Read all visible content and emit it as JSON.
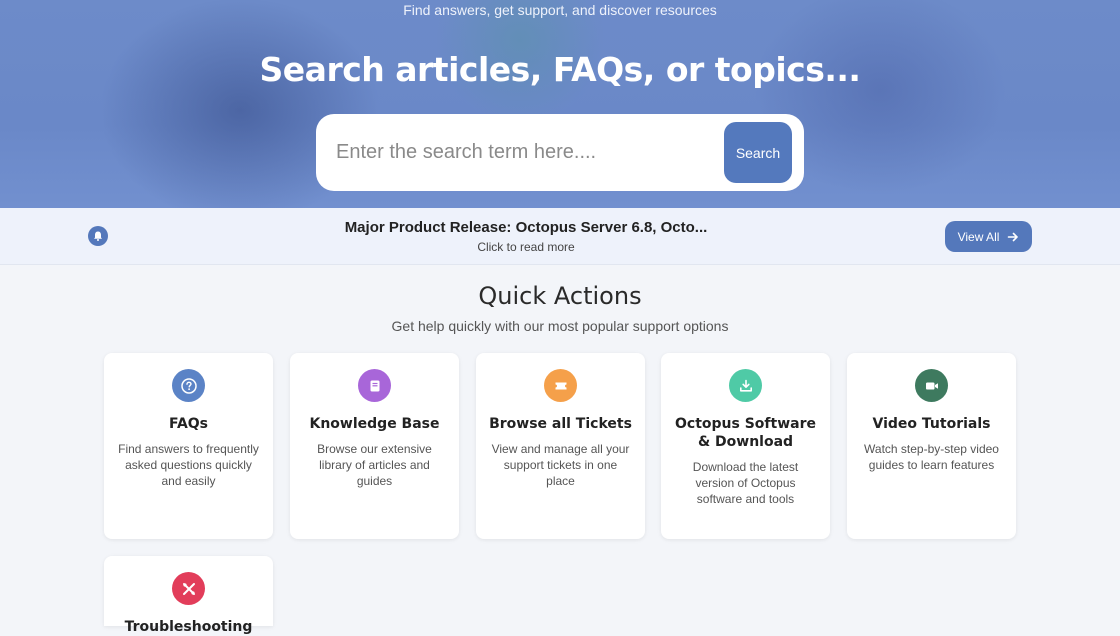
{
  "hero": {
    "subtitle": "Find answers, get support, and discover resources",
    "title": "Search articles, FAQs, or topics...",
    "search_placeholder": "Enter the search term here....",
    "search_button": "Search"
  },
  "announcement": {
    "title": "Major Product Release: Octopus Server 6.8, Octo...",
    "subtitle": "Click to read more",
    "view_all": "View All",
    "icon": "bell-icon"
  },
  "quick_actions": {
    "title": "Quick Actions",
    "subtitle": "Get help quickly with our most popular support options",
    "cards": [
      {
        "title": "FAQs",
        "desc": "Find answers to frequently asked questions quickly and easily",
        "icon": "question-icon",
        "color": "#5b83c6"
      },
      {
        "title": "Knowledge Base",
        "desc": "Browse our extensive library of articles and guides",
        "icon": "book-icon",
        "color": "#a866d9"
      },
      {
        "title": "Browse all Tickets",
        "desc": "View and manage all your support tickets in one place",
        "icon": "ticket-icon",
        "color": "#f5a04a"
      },
      {
        "title": "Octopus Software & Download",
        "desc": "Download the latest version of Octopus software and tools",
        "icon": "download-icon",
        "color": "#4fcaa6"
      },
      {
        "title": "Video Tutorials",
        "desc": "Watch step-by-step video guides to learn features",
        "icon": "video-icon",
        "color": "#3e7a5f"
      },
      {
        "title": "Troubleshooting",
        "desc": "",
        "icon": "tools-icon",
        "color": "#e23d5a"
      }
    ]
  }
}
